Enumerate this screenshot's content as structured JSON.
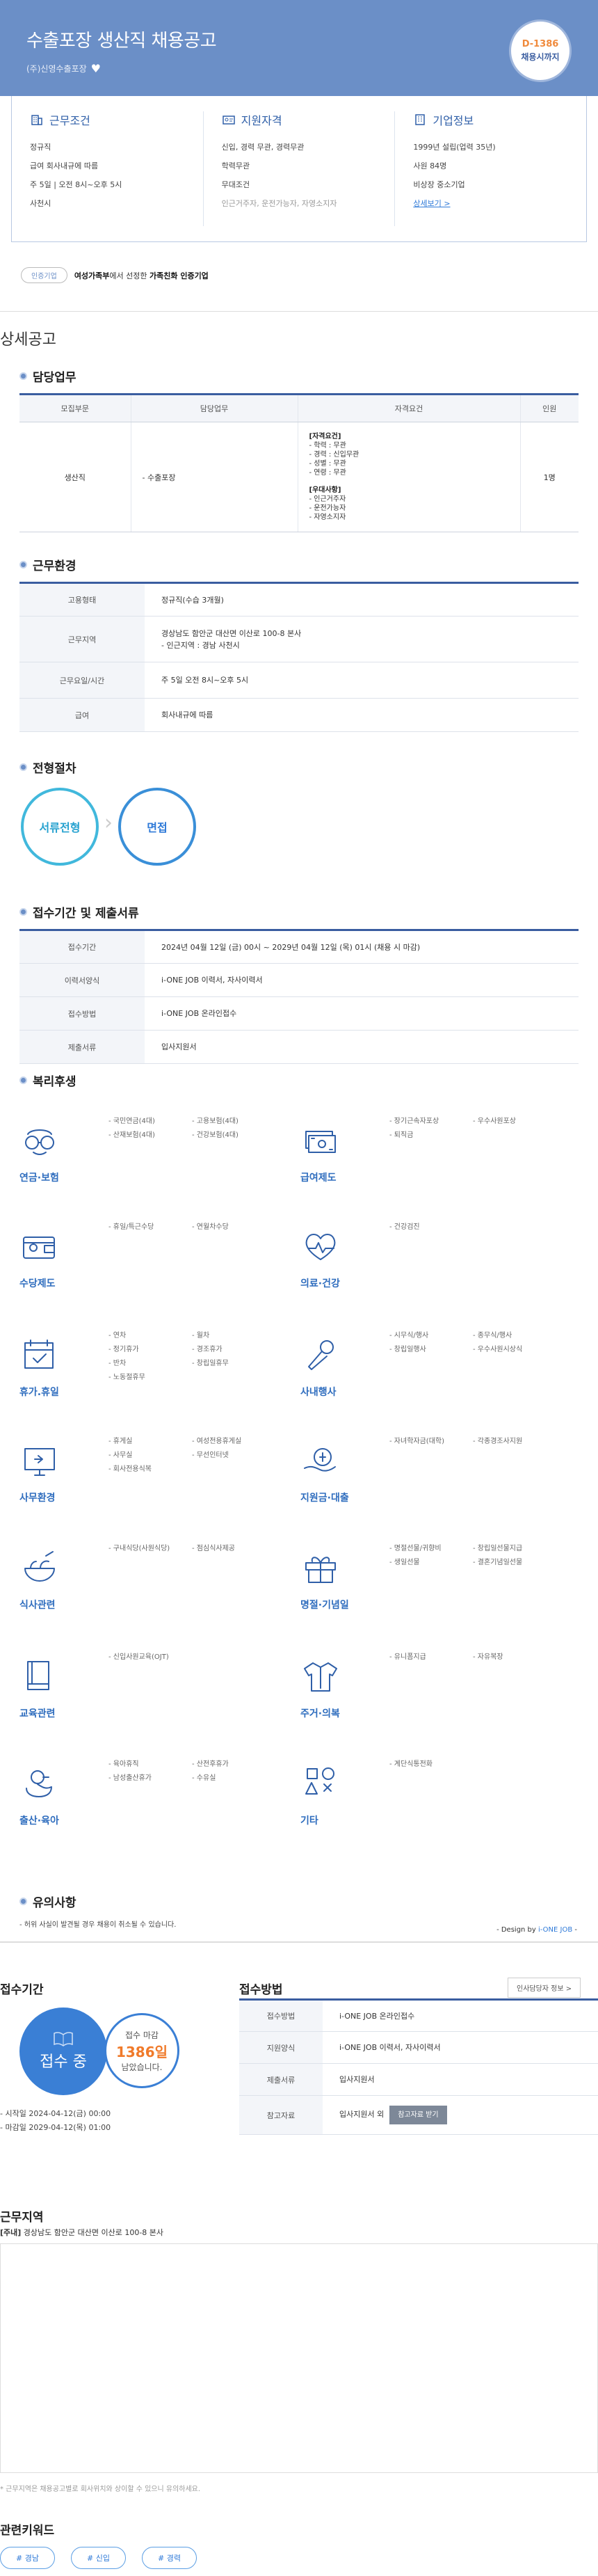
{
  "hero": {
    "title": "수출포장 생산직 채용공고",
    "company": "(주)신영수출포장",
    "dday": "D-1386",
    "dday_sub": "채용시까지"
  },
  "summary": {
    "conditions": {
      "title": "근무조건",
      "items": [
        "정규직",
        "급여 회사내규에 따름",
        "주 5일 | 오전 8시~오후 5시",
        "사천시"
      ]
    },
    "qualifications": {
      "title": "지원자격",
      "items": [
        "신입, 경력 무관, 경력무관",
        "학력무관",
        "무대조건"
      ],
      "note": "인근거주자, 운전가능자, 자영소지자"
    },
    "company_info": {
      "title": "기업정보",
      "items": [
        "1999년 설립(업력 35년)",
        "사원 84명",
        "비상장 중소기업"
      ],
      "link": "상세보기 >"
    }
  },
  "cert": {
    "badge": "인증기업",
    "text_pre": "여성가족부",
    "text_mid": "에서 선정한 ",
    "text_bold": "가족친화 인증기업"
  },
  "detail_heading": "상세공고",
  "duty": {
    "title": "담당업무",
    "headers": [
      "모집부문",
      "담당업무",
      "자격요건",
      "인원"
    ],
    "row": {
      "field": "생산직",
      "task": "- 수출포장",
      "req_title": "[자격요건]",
      "req": [
        "- 학력 : 무관",
        "- 경력 : 신입무관",
        "- 성별 : 무관",
        "- 연령 : 무관"
      ],
      "pref_title": "[우대사항]",
      "pref": [
        "- 인근거주자",
        "- 운전가능자",
        "- 자영소지자"
      ],
      "count": "1명"
    }
  },
  "work": {
    "title": "근무환경",
    "rows": [
      {
        "k": "고용형태",
        "v": [
          "정규직(수습 3개월)"
        ]
      },
      {
        "k": "근무지역",
        "v": [
          "경상남도 함안군 대산면 이산로 100-8 본사",
          "- 인근지역 : 경남 사천시"
        ]
      },
      {
        "k": "근무요일/시간",
        "v": [
          "주 5일 오전 8시~오후 5시"
        ]
      },
      {
        "k": "급여",
        "v": [
          "회사내규에 따름"
        ]
      }
    ]
  },
  "process": {
    "title": "전형절차",
    "steps": [
      "서류전형",
      "면접"
    ],
    "chevron": "›"
  },
  "period": {
    "title": "접수기간 및 제출서류",
    "rows": [
      {
        "k": "접수기간",
        "v": "2024년 04월 12일 (금) 00시 ~ 2029년 04월 12일 (목) 01시 (채용 시 마감)"
      },
      {
        "k": "이력서양식",
        "v": "i-ONE JOB 이력서, 자사이력서"
      },
      {
        "k": "접수방법",
        "v": "i-ONE JOB 온라인접수"
      },
      {
        "k": "제출서류",
        "v": "입사지원서"
      }
    ]
  },
  "benefits": {
    "title": "복리후생",
    "groups": [
      {
        "name": "연금·보험",
        "icon": "glasses-icon",
        "items": [
          "국민연금(4대)",
          "고용보험(4대)",
          "산재보험(4대)",
          "건강보험(4대)"
        ]
      },
      {
        "name": "급여제도",
        "icon": "money-icon",
        "items": [
          "장기근속자포상",
          "우수사원포상",
          "퇴직금"
        ]
      },
      {
        "name": "수당제도",
        "icon": "wallet-icon",
        "items": [
          "휴일/특근수당",
          "연월차수당"
        ]
      },
      {
        "name": "의료·건강",
        "icon": "heart-icon",
        "items": [
          "건강검진"
        ]
      },
      {
        "name": "휴가.휴일",
        "icon": "calendar-icon",
        "items": [
          "연차",
          "월차",
          "정기휴가",
          "경조휴가",
          "반차",
          "창립일휴무",
          "노동절휴무"
        ]
      },
      {
        "name": "사내행사",
        "icon": "microphone-icon",
        "items": [
          "시무식/행사",
          "종무식/행사",
          "창립일행사",
          "우수사원시상식"
        ]
      },
      {
        "name": "사무환경",
        "icon": "monitor-icon",
        "items": [
          "휴게실",
          "여성전용휴게실",
          "사무실",
          "무선인터넷",
          "회사전용식복"
        ]
      },
      {
        "name": "지원금·대출",
        "icon": "coin-hand-icon",
        "items": [
          "자녀학자금(대학)",
          "각종경조사지원"
        ]
      },
      {
        "name": "식사관련",
        "icon": "bowl-icon",
        "items": [
          "구내식당(사원식당)",
          "점심식사제공"
        ]
      },
      {
        "name": "명절·기념일",
        "icon": "gift-icon",
        "items": [
          "명절선물/귀향비",
          "창립일선물지급",
          "생일선물",
          "결혼기념일선물"
        ]
      },
      {
        "name": "교육관련",
        "icon": "book-icon",
        "items": [
          "신입사원교육(OJT)"
        ]
      },
      {
        "name": "주거·의복",
        "icon": "shirt-icon",
        "items": [
          "유니폼지급",
          "자유복장"
        ]
      },
      {
        "name": "출산·육아",
        "icon": "duck-icon",
        "items": [
          "육아휴직",
          "산전후휴가",
          "남성출산휴가",
          "수유실"
        ]
      },
      {
        "name": "기타",
        "icon": "shapes-icon",
        "items": [
          "계단식통전화"
        ]
      }
    ]
  },
  "notice": {
    "title": "유의사항",
    "text": "- 허위 사실이 발견될 경우 채용이 취소될 수 있습니다.",
    "credit_pre": "- Design by ",
    "credit_brand": "i-ONE JOB",
    "credit_post": " -"
  },
  "apply": {
    "period_title": "접수기간",
    "status": "접수 중",
    "deadline_label": "접수 마감",
    "deadline_days": "1386일",
    "deadline_suffix": "",
    "deadline_tail": "남았습니다.",
    "start": "- 시작일 2024-04-12(금) 00:00",
    "end": "- 마감일 2029-04-12(목) 01:00",
    "method_title": "접수방법",
    "hr_button": "인사담당자 정보  >",
    "rows": [
      {
        "k": "접수방법",
        "v": "i-ONE JOB 온라인접수"
      },
      {
        "k": "지원양식",
        "v": "i-ONE JOB 이력서, 자사이력서"
      },
      {
        "k": "제출서류",
        "v": "입사지원서"
      },
      {
        "k": "참고자료",
        "v": "입사지원서 외"
      }
    ],
    "ref_button": "참고자료 받기"
  },
  "location": {
    "title": "근무지역",
    "label": "[주내]",
    "address": "경상남도 함안군 대산면 이산로 100-8 본사",
    "note": "* 근무지역은 채용공고별로 회사위치와 상이할 수 있으니 유의하세요."
  },
  "keywords": {
    "title": "관련키워드",
    "items": [
      "# 경남",
      "# 신입",
      "# 경력"
    ]
  }
}
